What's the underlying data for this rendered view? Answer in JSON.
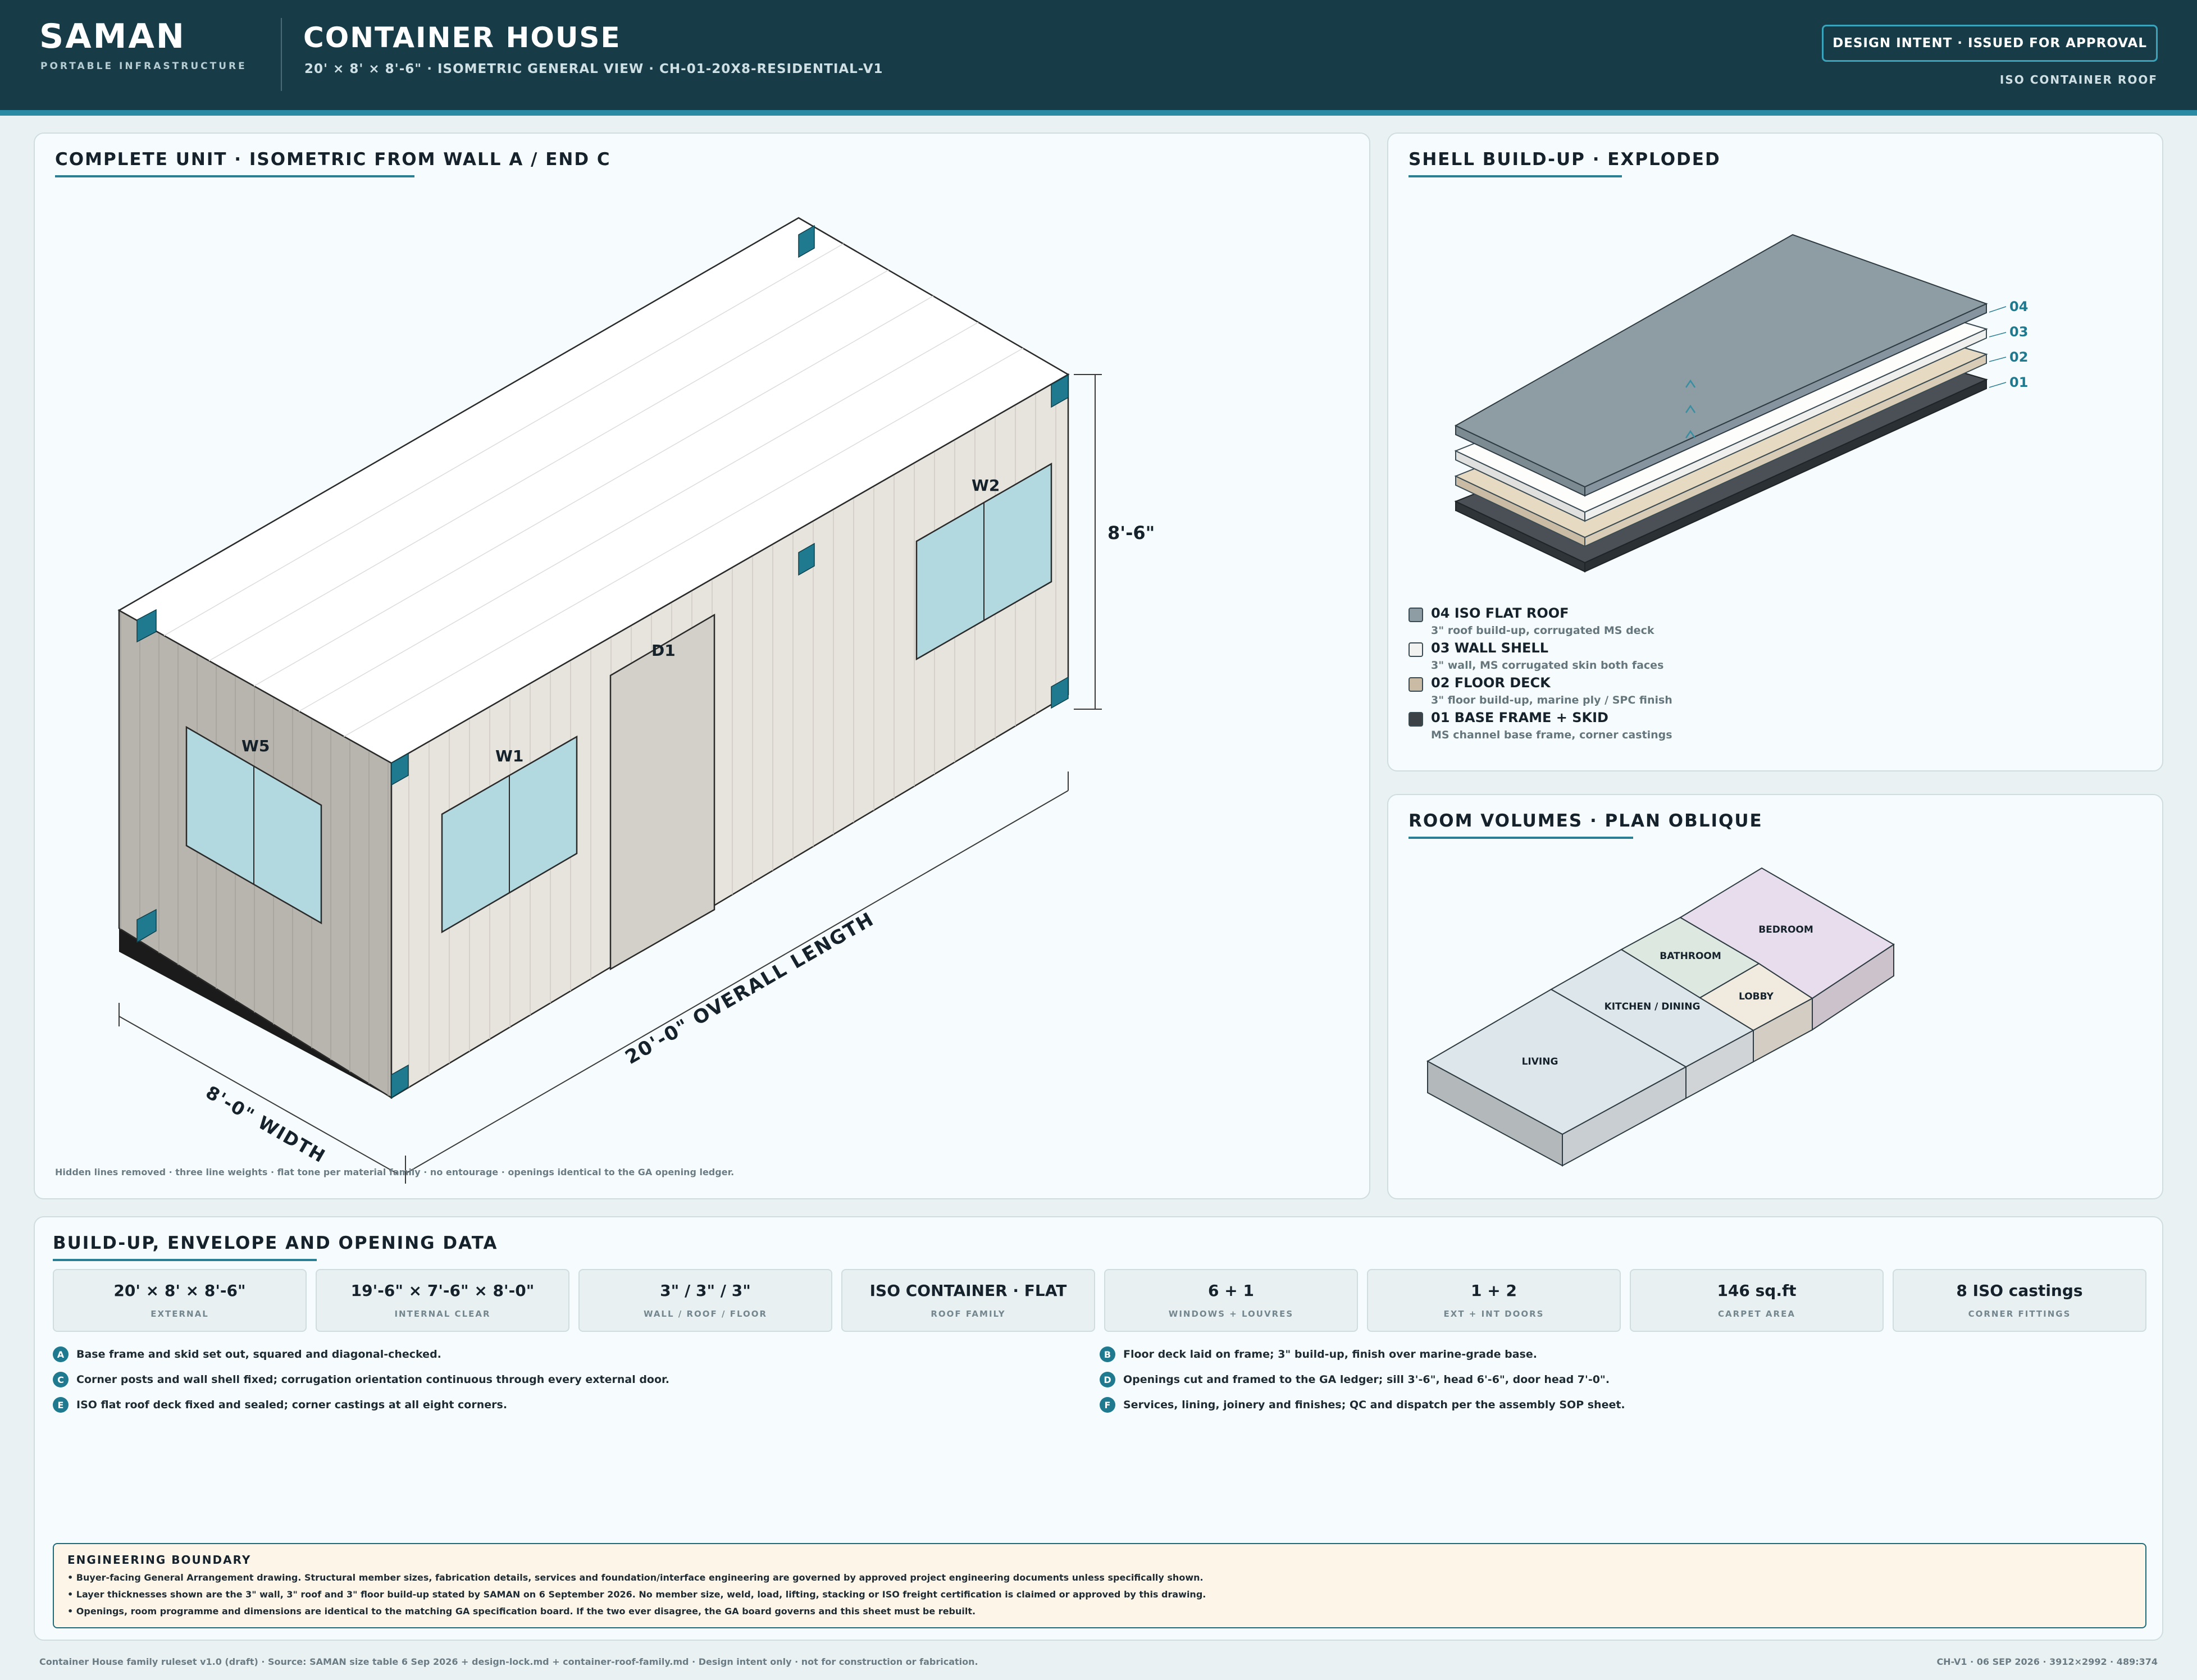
{
  "header": {
    "brand": "SAMAN",
    "brand_sub": "PORTABLE INFRASTRUCTURE",
    "title": "CONTAINER HOUSE",
    "subtitle": "20' × 8' × 8'-6\" · ISOMETRIC GENERAL VIEW · CH-01-20X8-RESIDENTIAL-V1",
    "status": "DESIGN INTENT · ISSUED FOR APPROVAL",
    "roof_tag": "ISO CONTAINER ROOF"
  },
  "iso_panel": {
    "title": "COMPLETE UNIT · ISOMETRIC FROM WALL A / END C",
    "labels": {
      "w1": "W1",
      "w2": "W2",
      "w5": "W5",
      "d1": "D1",
      "height_dim": "8'-6\"",
      "length_dim": "20'-0\" OVERALL LENGTH",
      "width_dim": "8'-0\" WIDTH"
    },
    "footnote": "Hidden lines removed · three line weights · flat tone per material family · no entourage · openings identical to the GA opening ledger."
  },
  "shell_panel": {
    "title": "SHELL BUILD-UP · EXPLODED",
    "layer_numbers": [
      "04",
      "03",
      "02",
      "01"
    ],
    "legend": [
      {
        "label": "04 ISO FLAT ROOF",
        "desc": "3\" roof build-up, corrugated MS deck",
        "color": "#8e9ca3"
      },
      {
        "label": "03 WALL SHELL",
        "desc": "3\" wall, MS corrugated skin both faces",
        "color": "#f2f2f0"
      },
      {
        "label": "02 FLOOR DECK",
        "desc": "3\" floor build-up, marine ply / SPC finish",
        "color": "#c9bba4"
      },
      {
        "label": "01 BASE FRAME + SKID",
        "desc": "MS channel base frame, corner castings",
        "color": "#3d4247"
      }
    ]
  },
  "rooms_panel": {
    "title": "ROOM VOLUMES · PLAN OBLIQUE",
    "rooms": {
      "living": "LIVING",
      "kitchen": "KITCHEN / DINING",
      "bathroom": "BATHROOM",
      "lobby": "LOBBY",
      "bedroom": "BEDROOM"
    }
  },
  "data_panel": {
    "title": "BUILD-UP, ENVELOPE AND OPENING DATA",
    "stats": [
      {
        "value": "20' × 8' × 8'-6\"",
        "label": "EXTERNAL"
      },
      {
        "value": "19'-6\" × 7'-6\" × 8'-0\"",
        "label": "INTERNAL CLEAR"
      },
      {
        "value": "3\" / 3\" / 3\"",
        "label": "WALL / ROOF / FLOOR"
      },
      {
        "value": "ISO CONTAINER · FLAT",
        "label": "ROOF FAMILY"
      },
      {
        "value": "6 + 1",
        "label": "WINDOWS + LOUVRES"
      },
      {
        "value": "1 + 2",
        "label": "EXT + INT DOORS"
      },
      {
        "value": "146 sq.ft",
        "label": "CARPET AREA"
      },
      {
        "value": "8 ISO castings",
        "label": "CORNER FITTINGS"
      }
    ],
    "steps": [
      {
        "key": "A",
        "text": "Base frame and skid set out, squared and diagonal-checked."
      },
      {
        "key": "B",
        "text": "Floor deck laid on frame; 3\" build-up, finish over marine-grade base."
      },
      {
        "key": "C",
        "text": "Corner posts and wall shell fixed; corrugation orientation continuous through every external door."
      },
      {
        "key": "D",
        "text": "Openings cut and framed to the GA ledger; sill 3'-6\", head 6'-6\", door head 7'-0\"."
      },
      {
        "key": "E",
        "text": "ISO flat roof deck fixed and sealed; corner castings at all eight corners."
      },
      {
        "key": "F",
        "text": "Services, lining, joinery and finishes; QC and dispatch per the assembly SOP sheet."
      }
    ],
    "boundary": {
      "title": "ENGINEERING BOUNDARY",
      "lines": [
        "• Buyer-facing General Arrangement drawing. Structural member sizes, fabrication details, services and foundation/interface engineering are governed by approved project engineering documents unless specifically shown.",
        "• Layer thicknesses shown are the 3\" wall, 3\" roof and 3\" floor build-up stated by SAMAN on 6 September 2026. No member size, weld, load, lifting, stacking or ISO freight certification is claimed or approved by this drawing.",
        "• Openings, room programme and dimensions are identical to the matching GA specification board. If the two ever disagree, the GA board governs and this sheet must be rebuilt."
      ]
    }
  },
  "footer": {
    "left": "Container House family ruleset v1.0 (draft) · Source: SAMAN size table 6 Sep 2026 + design-lock.md + container-roof-family.md · Design intent only · not for construction or fabrication.",
    "right": "CH-V1 · 06 SEP 2026 · 3912×2992 · 489:374"
  },
  "colors": {
    "header_bg": "#173b47",
    "accent": "#2a8aa3",
    "casting": "#1f7a8f",
    "glass": "#b3d9e0",
    "wall": "#e7e4dd",
    "end_wall": "#b8b5ae",
    "door": "#d3d0c9",
    "roof": "#ffffff",
    "skid": "#1b1b1b"
  }
}
